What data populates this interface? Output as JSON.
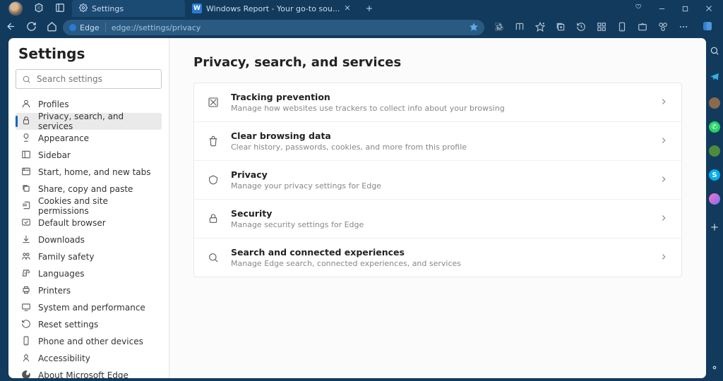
{
  "tabs": [
    {
      "label": "Settings",
      "icon": "gear"
    },
    {
      "label": "Windows Report - Your go-to sou...",
      "icon": "w"
    }
  ],
  "address": {
    "chip": "Edge",
    "url": "edge://settings/privacy"
  },
  "sidebar": {
    "title": "Settings",
    "searchPlaceholder": "Search settings",
    "items": [
      "Profiles",
      "Privacy, search, and services",
      "Appearance",
      "Sidebar",
      "Start, home, and new tabs",
      "Share, copy and paste",
      "Cookies and site permissions",
      "Default browser",
      "Downloads",
      "Family safety",
      "Languages",
      "Printers",
      "System and performance",
      "Reset settings",
      "Phone and other devices",
      "Accessibility",
      "About Microsoft Edge"
    ],
    "activeIndex": 1
  },
  "main": {
    "heading": "Privacy, search, and services",
    "rows": [
      {
        "title": "Tracking prevention",
        "sub": "Manage how websites use trackers to collect info about your browsing"
      },
      {
        "title": "Clear browsing data",
        "sub": "Clear history, passwords, cookies, and more from this profile"
      },
      {
        "title": "Privacy",
        "sub": "Manage your privacy settings for Edge"
      },
      {
        "title": "Security",
        "sub": "Manage security settings for Edge"
      },
      {
        "title": "Search and connected experiences",
        "sub": "Manage Edge search, connected experiences, and services"
      }
    ]
  }
}
